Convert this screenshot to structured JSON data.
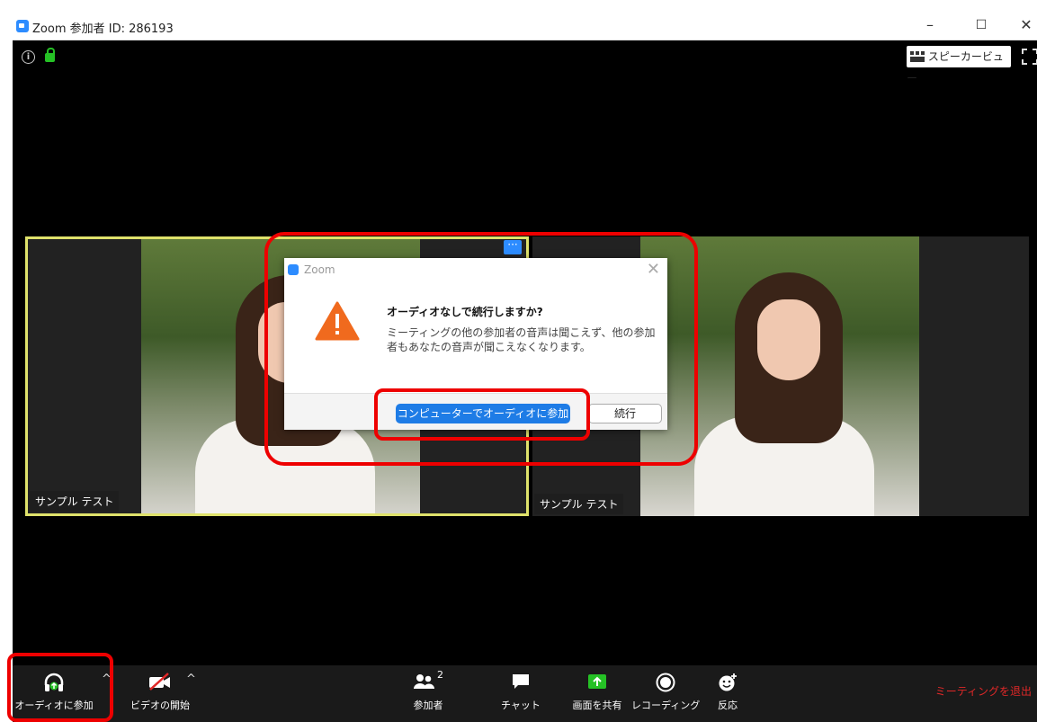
{
  "window": {
    "title": "Zoom 参加者 ID: 286193",
    "minimize": "–",
    "maximize": "☐",
    "close": "✕"
  },
  "top_controls": {
    "speaker_view": "スピーカービュー"
  },
  "participants": [
    {
      "name": "サンプル テスト"
    },
    {
      "name": "サンプル テスト"
    }
  ],
  "tile_menu": "···",
  "dialog": {
    "title": "Zoom",
    "heading": "オーディオなしで続行しますか?",
    "body": "ミーティングの他の参加者の音声は聞こえず、他の参加者もあなたの音声が聞こえなくなります。",
    "primary_button": "コンピューターでオーディオに参加",
    "secondary_button": "続行",
    "close": "✕"
  },
  "toolbar": {
    "audio": "オーディオに参加",
    "video": "ビデオの開始",
    "participants": "参加者",
    "participant_count": "2",
    "chat": "チャット",
    "share": "画面を共有",
    "record": "レコーディング",
    "reactions": "反応",
    "leave": "ミーティングを退出"
  },
  "colors": {
    "accent": "#2d8cff",
    "primary_button": "#1e7ce6",
    "highlight": "#e00000",
    "leave": "#e02828",
    "active_tile_border": "#dfe26b"
  }
}
